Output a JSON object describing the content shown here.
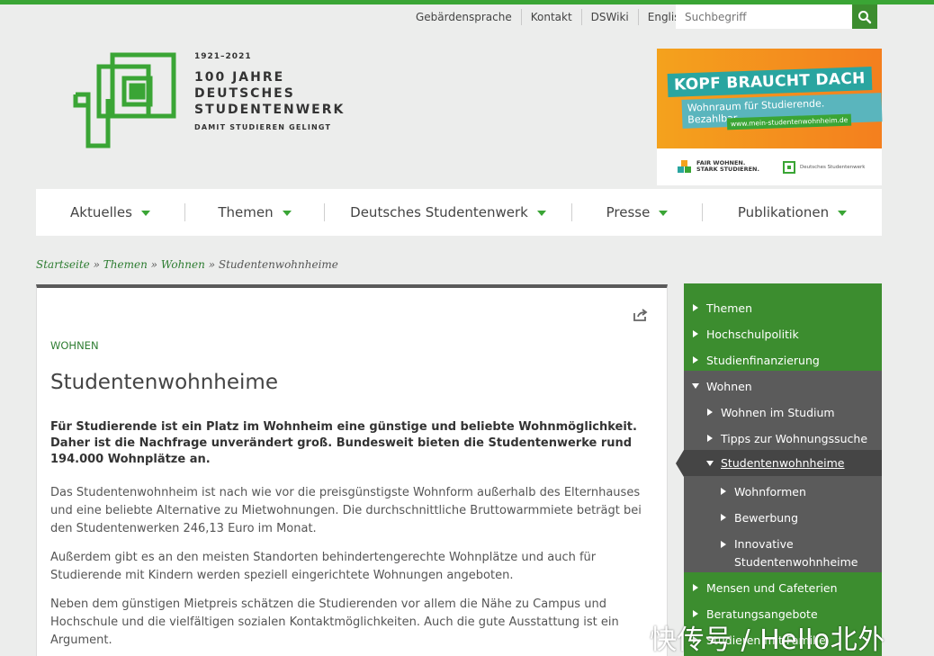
{
  "colors": {
    "brand_green": "#3aa535",
    "dark_green": "#3c8d2f",
    "sidebar_dark": "#5b5b5b",
    "banner_orange": "#f4a21d"
  },
  "utility_nav": [
    "Gebärdensprache",
    "Kontakt",
    "DSWiki",
    "English"
  ],
  "search": {
    "placeholder": "Suchbegriff",
    "icon": "search-icon"
  },
  "logo": {
    "years": "1921–2021",
    "line1": "100 JAHRE",
    "line2": "DEUTSCHES",
    "line3": "STUDENTENWERK",
    "tagline": "DAMIT STUDIEREN GELINGT"
  },
  "banner": {
    "headline": "KOPF BRAUCHT DACH",
    "subline": "Wohnraum für Studierende. Bezahlbar.",
    "url": "www.mein-studentenwohnheim.de",
    "fair_line1": "FAIR WOHNEN.",
    "fair_line2": "STARK STUDIEREN.",
    "dsw_label": "Deutsches Studentenwerk"
  },
  "main_nav": [
    "Aktuelles",
    "Themen",
    "Deutsches Studentenwerk",
    "Presse",
    "Publikationen"
  ],
  "breadcrumb": {
    "items": [
      "Startseite",
      "Themen",
      "Wohnen"
    ],
    "separator": "»",
    "current": "Studentenwohnheime"
  },
  "article": {
    "kicker": "WOHNEN",
    "title": "Studentenwohnheime",
    "lead": "Für Studierende ist ein Platz im Wohnheim eine günstige und beliebte Wohnmöglichkeit. Daher ist die Nachfrage unverändert groß. Bundesweit bieten die Studentenwerke rund 194.000 Wohnplätze an.",
    "paragraphs": [
      "Das Studentenwohnheim ist nach wie vor die preisgünstigste Wohnform außerhalb des Elternhauses und eine beliebte Alternative zu Mietwohnungen. Die durchschnittliche Bruttowarmmiete beträgt bei den Studentenwerken 246,13 Euro im Monat.",
      "Außerdem gibt es an den meisten Standorten behindertengerechte Wohnplätze und auch für Studierende mit Kindern werden speziell eingerichtete Wohnungen angeboten.",
      "Neben dem günstigen Mietpreis schätzen die Studierenden vor allem die Nähe zu Campus und Hochschule und die vielfältigen sozialen Kontaktmöglichkeiten. Auch die gute Ausstattung ist ein Argument."
    ]
  },
  "sidebar": {
    "themen": "Themen",
    "hochschulpolitik": "Hochschulpolitik",
    "studienfinanzierung": "Studienfinanzierung",
    "wohnen": "Wohnen",
    "wohnen_im_studium": "Wohnen im Studium",
    "tipps": "Tipps zur Wohnungssuche",
    "studentenwohnheime": "Studentenwohnheime",
    "wohnformen": "Wohnformen",
    "bewerbung": "Bewerbung",
    "innovative_1": "Innovative",
    "innovative_2": "Studentenwohnheime",
    "mensen": "Mensen und Cafeterien",
    "beratung": "Beratungsangebote",
    "familie": "Studieren mit Familie"
  },
  "watermark": "快传号 / Hello北外"
}
